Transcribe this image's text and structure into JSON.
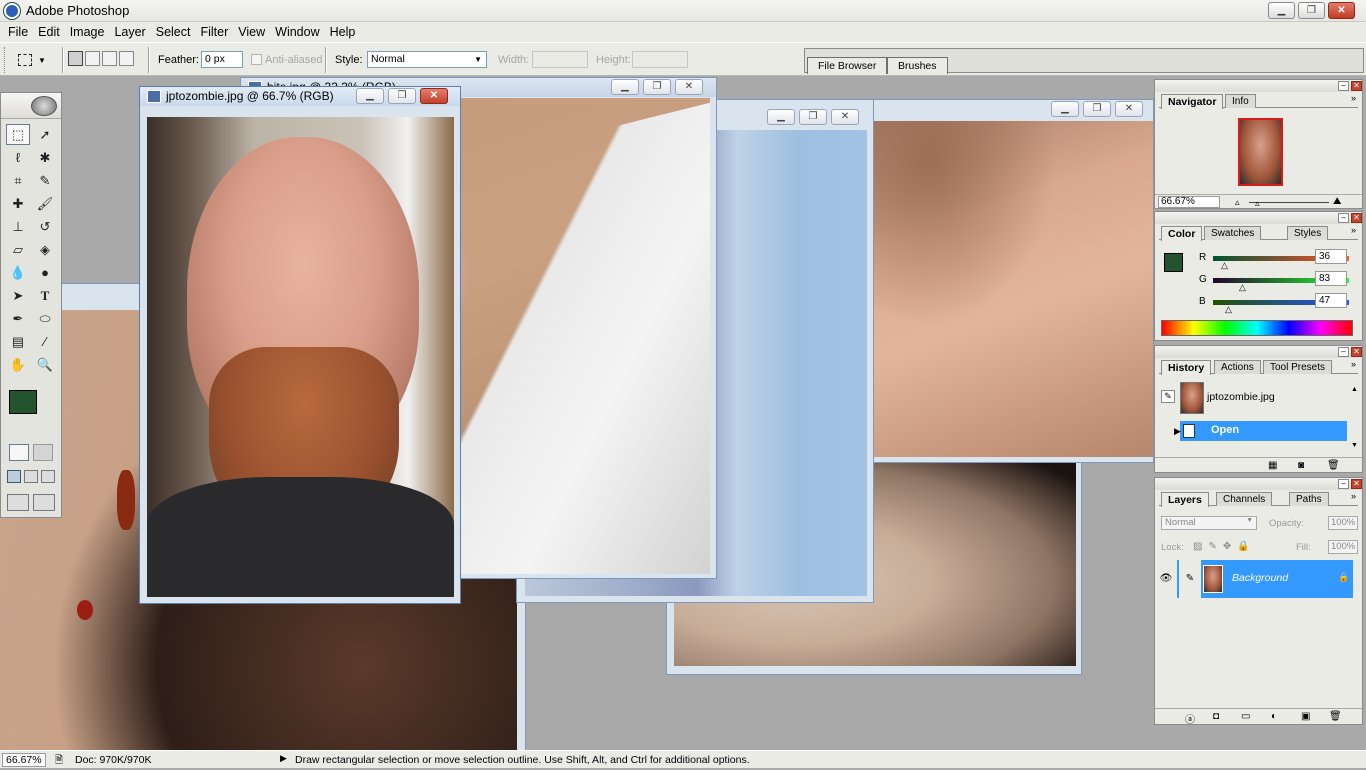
{
  "app": {
    "title": "Adobe Photoshop"
  },
  "menu": [
    "File",
    "Edit",
    "Image",
    "Layer",
    "Select",
    "Filter",
    "View",
    "Window",
    "Help"
  ],
  "options": {
    "feather_label": "Feather:",
    "feather_value": "0 px",
    "antialiased_label": "Anti-aliased",
    "style_label": "Style:",
    "style_value": "Normal",
    "width_label": "Width:",
    "height_label": "Height:"
  },
  "well": {
    "tabs": [
      "File Browser",
      "Brushes"
    ]
  },
  "documents": {
    "front": {
      "title": "jptozombie.jpg @ 66.7% (RGB)"
    },
    "back": {
      "title": "bite.jpg @ 33.3% (RGB)"
    }
  },
  "navigator": {
    "tabs": [
      "Navigator",
      "Info"
    ],
    "zoom": "66.67%"
  },
  "color": {
    "tabs": [
      "Color",
      "Swatches",
      "Styles"
    ],
    "r_label": "R",
    "g_label": "G",
    "b_label": "B",
    "r": "36",
    "g": "83",
    "b": "47",
    "foreground": "#24532f"
  },
  "history": {
    "tabs": [
      "History",
      "Actions",
      "Tool Presets"
    ],
    "snapshot": "jptozombie.jpg",
    "step": "Open"
  },
  "layers": {
    "tabs": [
      "Layers",
      "Channels",
      "Paths"
    ],
    "blend": "Normal",
    "opacity_label": "Opacity:",
    "opacity": "100%",
    "lock_label": "Lock:",
    "fill_label": "Fill:",
    "fill": "100%",
    "layer_name": "Background"
  },
  "status": {
    "zoom": "66.67%",
    "doc": "Doc: 970K/970K",
    "hint": "Draw rectangular selection or move selection outline.  Use Shift, Alt, and Ctrl for additional options."
  }
}
